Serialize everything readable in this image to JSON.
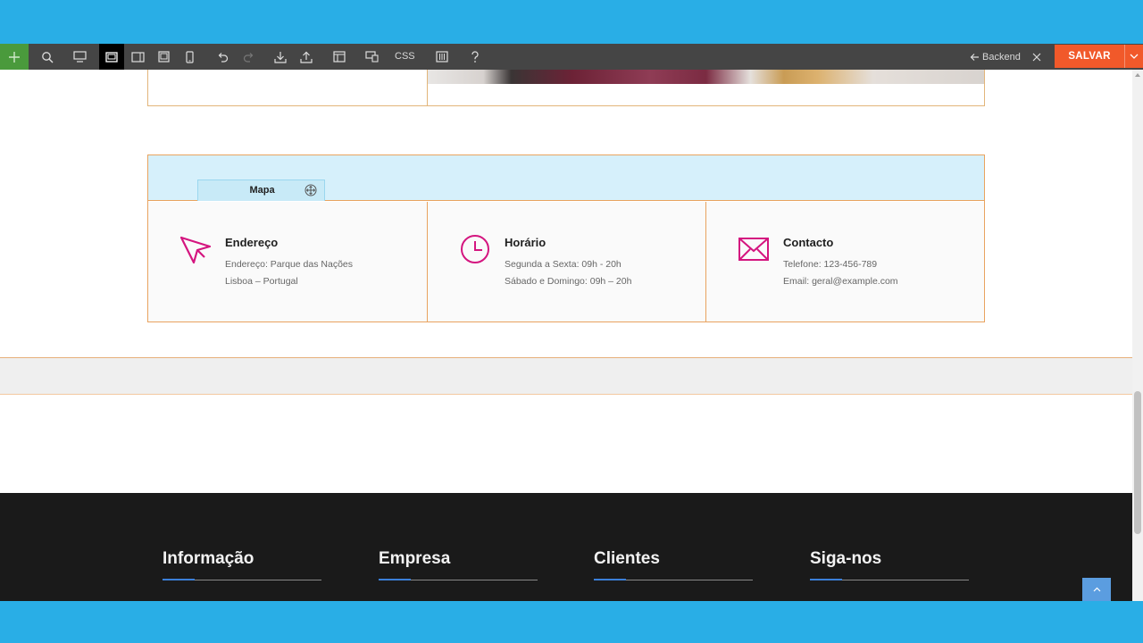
{
  "toolbar": {
    "css_label": "CSS",
    "backend_label": "Backend",
    "save_label": "SALVAR"
  },
  "map": {
    "label": "Mapa"
  },
  "info": [
    {
      "title": "Endereço",
      "line1": "Endereço: Parque das Nações",
      "line2": "Lisboa – Portugal",
      "icon": "cursor-arrow-icon"
    },
    {
      "title": "Horário",
      "line1": "Segunda a Sexta: 09h - 20h",
      "line2": "Sábado e Domingo: 09h – 20h",
      "icon": "clock-icon"
    },
    {
      "title": "Contacto",
      "line1": "Telefone: 123-456-789",
      "line2": "Email: geral@example.com",
      "icon": "envelope-icon"
    }
  ],
  "footer": {
    "columns": [
      "Informação",
      "Empresa",
      "Clientes",
      "Siga-nos"
    ]
  },
  "colors": {
    "toolbar_bg": "#454545",
    "save_button": "#f1592a",
    "icon_accent": "#d4157f",
    "outline": "#e9a35f",
    "footer_bg": "#1a1a1a",
    "footer_accent": "#3b7fd9"
  }
}
